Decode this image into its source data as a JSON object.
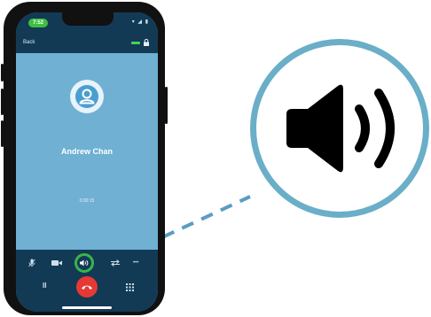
{
  "status_bar": {
    "time": "7:52",
    "icons": "▾ ◢ ▮"
  },
  "nav": {
    "back_label": "Back",
    "signal_color": "#44d35a"
  },
  "call": {
    "caller_name": "Andrew Chan",
    "duration": "0:00:15"
  },
  "controls": {
    "buttons": [
      {
        "name": "mute",
        "icon": "microphone-mute-icon"
      },
      {
        "name": "video",
        "icon": "video-camera-icon"
      },
      {
        "name": "speaker",
        "icon": "speaker-icon",
        "highlighted": true
      },
      {
        "name": "transfer",
        "icon": "transfer-icon"
      },
      {
        "name": "more",
        "icon": "more-icon",
        "label": "•••"
      },
      {
        "name": "hold",
        "icon": "pause-icon",
        "label": "II"
      },
      {
        "name": "end-call",
        "icon": "end-call-icon"
      },
      {
        "name": "keypad",
        "icon": "keypad-icon"
      }
    ]
  },
  "callout": {
    "icon": "speaker-volume-icon"
  },
  "colors": {
    "header": "#123a55",
    "call_background": "#6fb0d3",
    "highlight_ring": "#39b54a",
    "end_call": "#e53935",
    "callout_border": "#6aaec8",
    "dashed_line": "#5b9cc4"
  }
}
